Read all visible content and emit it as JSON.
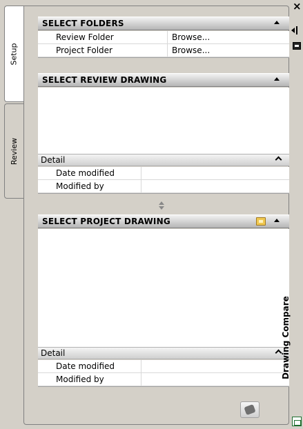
{
  "palette": {
    "title": "Drawing Compare",
    "close_icon": "close-icon",
    "pin_icon": "autohide-icon",
    "properties_icon": "properties-icon"
  },
  "tabs": [
    {
      "label": "Setup",
      "active": true
    },
    {
      "label": "Review",
      "active": false
    }
  ],
  "select_folders": {
    "header": "SELECT FOLDERS",
    "rows": [
      {
        "label": "Review Folder",
        "value": "Browse..."
      },
      {
        "label": "Project Folder",
        "value": "Browse..."
      }
    ]
  },
  "select_review_drawing": {
    "header": "SELECT REVIEW DRAWING",
    "detail_header": "Detail",
    "detail_rows": [
      {
        "label": "Date modified",
        "value": ""
      },
      {
        "label": "Modified by",
        "value": ""
      }
    ]
  },
  "select_project_drawing": {
    "header": "SELECT PROJECT DRAWING",
    "detail_header": "Detail",
    "detail_rows": [
      {
        "label": "Date modified",
        "value": ""
      },
      {
        "label": "Modified by",
        "value": ""
      }
    ]
  }
}
